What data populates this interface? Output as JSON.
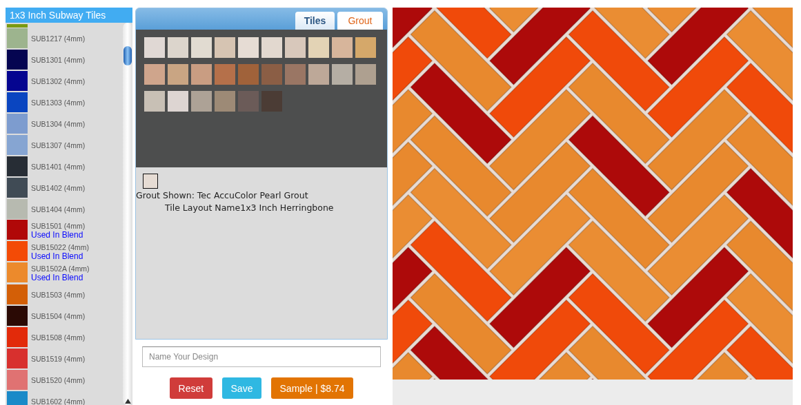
{
  "tile_list": {
    "title": "1x3 Inch Subway Tiles",
    "items": [
      {
        "kind": "partial",
        "color": "#7b9a12"
      },
      {
        "kind": "tile",
        "name": "SUB1217 (4mm)",
        "color": "#9db48e"
      },
      {
        "kind": "tile",
        "name": "SUB1301 (4mm)",
        "color": "#050551"
      },
      {
        "kind": "tile",
        "name": "SUB1302 (4mm)",
        "color": "#050590"
      },
      {
        "kind": "tile",
        "name": "SUB1303 (4mm)",
        "color": "#0a45c0"
      },
      {
        "kind": "tile",
        "name": "SUB1304 (4mm)",
        "color": "#7d9ccf"
      },
      {
        "kind": "tile",
        "name": "SUB1307 (4mm)",
        "color": "#86a5d2"
      },
      {
        "kind": "tile",
        "name": "SUB1401 (4mm)",
        "color": "#272d35"
      },
      {
        "kind": "tile",
        "name": "SUB1402 (4mm)",
        "color": "#404b55"
      },
      {
        "kind": "tile",
        "name": "SUB1404 (4mm)",
        "color": "#b7bab0"
      },
      {
        "kind": "tile",
        "name": "SUB1501 (4mm)",
        "note": "Used In Blend",
        "color": "#b00808"
      },
      {
        "kind": "tile",
        "name": "SUB15022 (4mm)",
        "note": "Used In Blend",
        "color": "#f34b06"
      },
      {
        "kind": "tile",
        "name": "SUB1502A (4mm)",
        "note": "Used In Blend",
        "color": "#ec8a2c"
      },
      {
        "kind": "tile",
        "name": "SUB1503 (4mm)",
        "color": "#d35f07"
      },
      {
        "kind": "tile",
        "name": "SUB1504 (4mm)",
        "color": "#2b0a05"
      },
      {
        "kind": "tile",
        "name": "SUB1508 (4mm)",
        "color": "#e22a0a"
      },
      {
        "kind": "tile",
        "name": "SUB1519 (4mm)",
        "color": "#d8302e"
      },
      {
        "kind": "tile",
        "name": "SUB1520 (4mm)",
        "color": "#e07272"
      },
      {
        "kind": "tile",
        "name": "SUB1602 (4mm)",
        "color": "#1a8ac8"
      }
    ]
  },
  "tabs": [
    {
      "label": "Tiles",
      "selected": false
    },
    {
      "label": "Grout",
      "selected": true
    }
  ],
  "grout_swatches": [
    {
      "color": "#e0d8d4"
    },
    {
      "color": "#dcd5cc"
    },
    {
      "color": "#e1dbd1"
    },
    {
      "color": "#d6c4b2"
    },
    {
      "color": "#e6dcd4"
    },
    {
      "color": "#e2d8cf"
    },
    {
      "color": "#d8c8bb"
    },
    {
      "color": "#e3d3b5"
    },
    {
      "color": "#d7b59b"
    },
    {
      "color": "#d5a86a"
    },
    {
      "color": "#cfa58c"
    },
    {
      "color": "#c9a583"
    },
    {
      "color": "#c99d82"
    },
    {
      "color": "#b5704a"
    },
    {
      "color": "#a0623a"
    },
    {
      "color": "#8b5e45"
    },
    {
      "color": "#9a7664"
    },
    {
      "color": "#bda898"
    },
    {
      "color": "#b5aea4"
    },
    {
      "color": "#aea090"
    },
    {
      "color": "#c8c0b5"
    },
    {
      "color": "#ddd5d2"
    },
    {
      "color": "#ada296"
    },
    {
      "color": "#9d8a76"
    },
    {
      "color": "#6b5b58"
    },
    {
      "color": "#4b3c35"
    }
  ],
  "grout_shown": {
    "color": "#e6dcd4",
    "text": "Grout Shown: Tec AccuColor Pearl Grout"
  },
  "layout_name": "Tile Layout Name1x3 Inch Herringbone",
  "design_name": {
    "placeholder": "Name Your Design"
  },
  "buttons": [
    {
      "label": "Reset",
      "kind": "reset"
    },
    {
      "label": "Save",
      "kind": "save"
    },
    {
      "label": "Sample | $8.74",
      "kind": "sample"
    }
  ]
}
